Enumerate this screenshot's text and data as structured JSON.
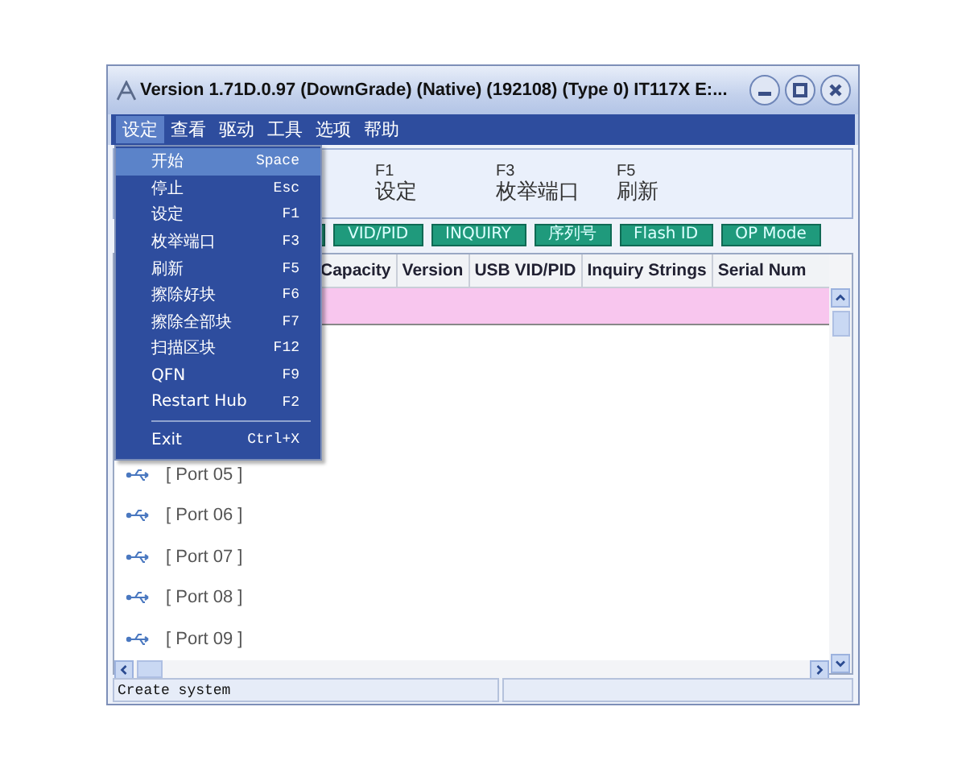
{
  "window": {
    "title": "Version 1.71D.0.97 (DownGrade) (Native) (192108) (Type 0) IT117X E:..."
  },
  "menu_bar": [
    {
      "label": "设定",
      "selected": true
    },
    {
      "label": "查看",
      "selected": false
    },
    {
      "label": "驱动",
      "selected": false
    },
    {
      "label": "工具",
      "selected": false
    },
    {
      "label": "选项",
      "selected": false
    },
    {
      "label": "帮助",
      "selected": false
    }
  ],
  "open_menu": {
    "items": [
      {
        "kind": "item",
        "label": "开始",
        "shortcut": "Space",
        "selected": true
      },
      {
        "kind": "item",
        "label": "停止",
        "shortcut": "Esc",
        "selected": false
      },
      {
        "kind": "item",
        "label": "设定",
        "shortcut": "F1",
        "selected": false
      },
      {
        "kind": "item",
        "label": "枚举端口",
        "shortcut": "F3",
        "selected": false
      },
      {
        "kind": "item",
        "label": "刷新",
        "shortcut": "F5",
        "selected": false
      },
      {
        "kind": "item",
        "label": "擦除好块",
        "shortcut": "F6",
        "selected": false
      },
      {
        "kind": "item",
        "label": "擦除全部块",
        "shortcut": "F7",
        "selected": false
      },
      {
        "kind": "item",
        "label": "扫描区块",
        "shortcut": "F12",
        "selected": false
      },
      {
        "kind": "item",
        "label": "QFN",
        "shortcut": "F9",
        "selected": false
      },
      {
        "kind": "item",
        "label": "Restart Hub",
        "shortcut": "F2",
        "selected": false
      },
      {
        "kind": "separator"
      },
      {
        "kind": "item",
        "label": "Exit",
        "shortcut": "Ctrl+X",
        "selected": false
      }
    ]
  },
  "toolbar": {
    "buttons": [
      {
        "key": "F1",
        "label": "设定"
      },
      {
        "key": "F3",
        "label": "枚举端口"
      },
      {
        "key": "F5",
        "label": "刷新"
      }
    ]
  },
  "column_buttons": [
    "VID/PID",
    "INQUIRY",
    "序列号",
    "Flash ID",
    "OP Mode"
  ],
  "table": {
    "columns": [
      "Capacity",
      "Version",
      "USB VID/PID",
      "Inquiry Strings",
      "Serial Num"
    ],
    "rows": [
      {
        "selected": true
      }
    ]
  },
  "ports": [
    "[ Port 05 ]",
    "[ Port 06 ]",
    "[ Port 07 ]",
    "[ Port 08 ]",
    "[ Port 09 ]"
  ],
  "status_bar": [
    "Create system"
  ]
}
